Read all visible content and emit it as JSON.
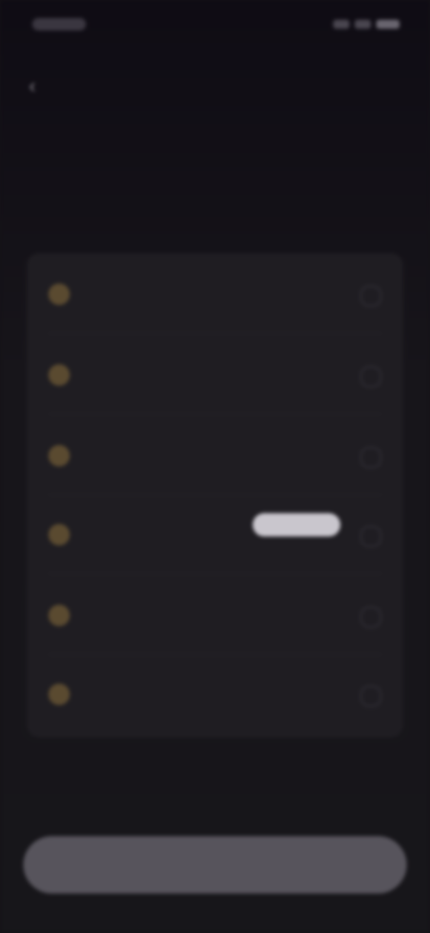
{
  "colors": {
    "background": "#17161a",
    "card": "#1f1d22",
    "accent_icon": "#5a4a30",
    "button": "#57545c",
    "pill": "#c9c6cd"
  },
  "header": {
    "back_icon": "chevron-left-icon",
    "title": ""
  },
  "headline": "",
  "subtext": "",
  "options": [
    {
      "label": "",
      "icon": "option-icon"
    },
    {
      "label": "",
      "icon": "option-icon"
    },
    {
      "label": "",
      "icon": "option-icon"
    },
    {
      "label": "",
      "icon": "option-icon"
    },
    {
      "label": "",
      "icon": "option-icon"
    },
    {
      "label": "",
      "icon": "option-icon"
    }
  ],
  "highlight_pill": "",
  "primary_button": {
    "label": ""
  }
}
